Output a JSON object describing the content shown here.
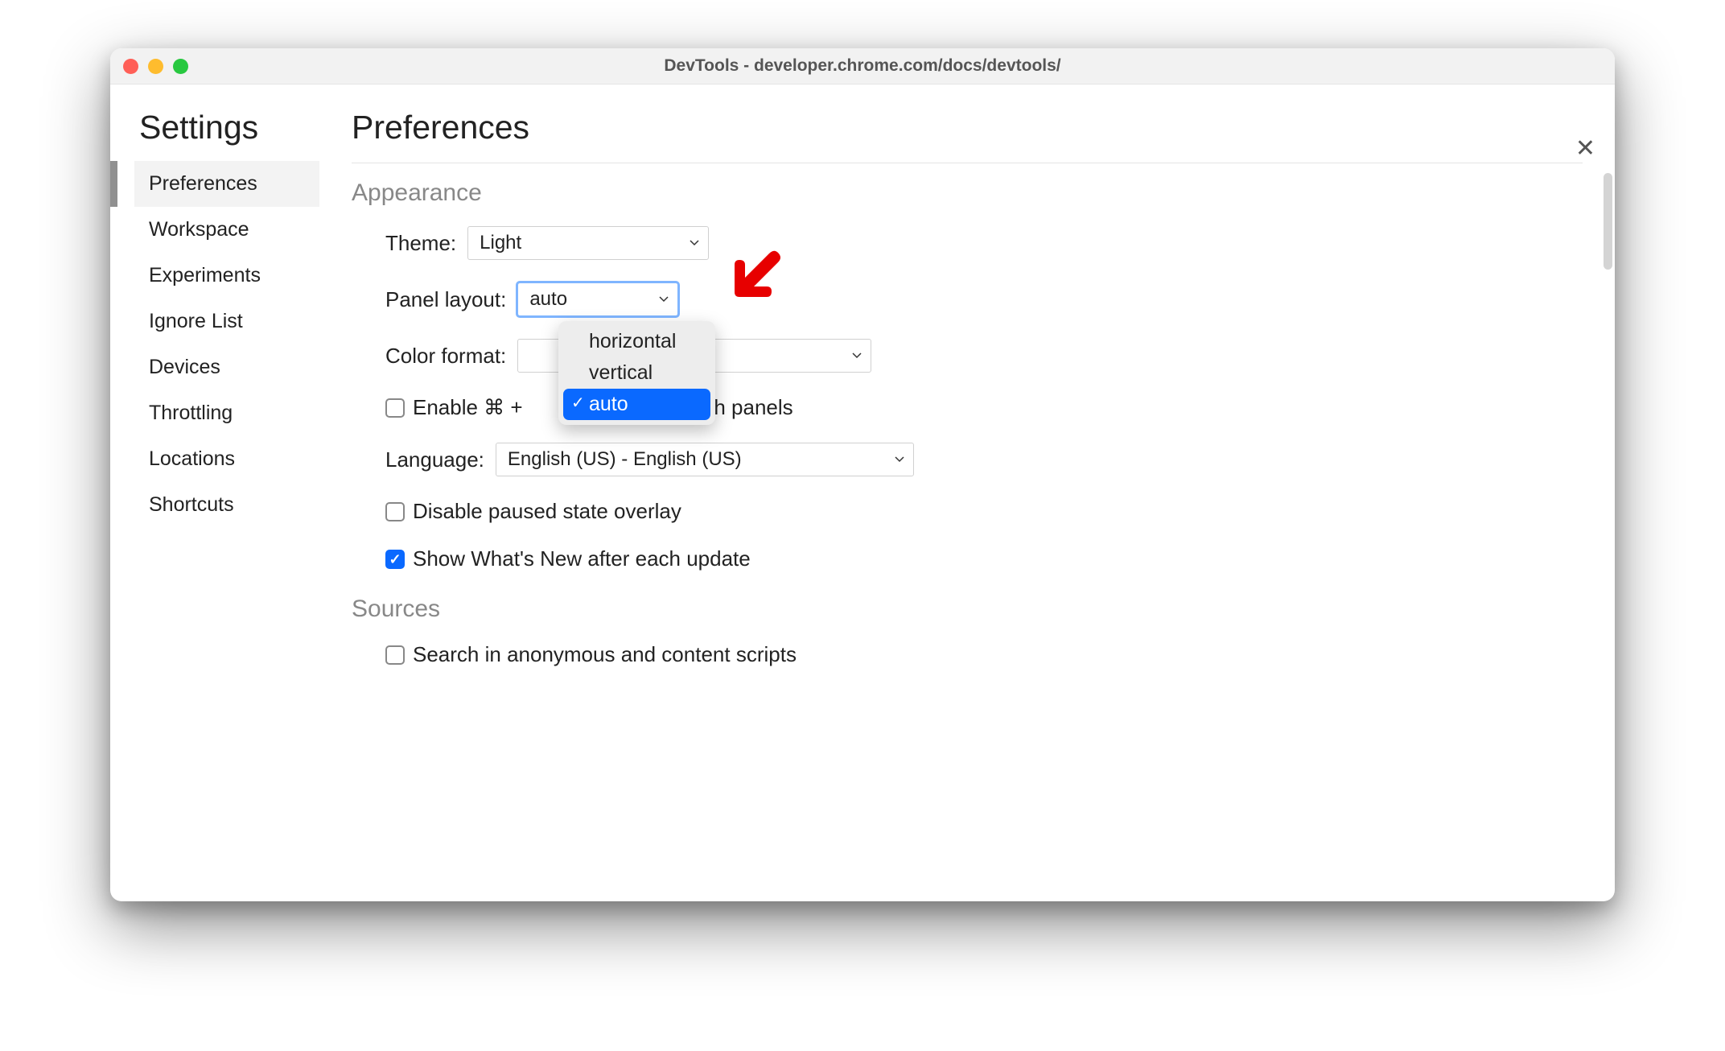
{
  "window": {
    "title": "DevTools - developer.chrome.com/docs/devtools/"
  },
  "sidebar": {
    "title": "Settings",
    "items": [
      {
        "label": "Preferences",
        "active": true
      },
      {
        "label": "Workspace",
        "active": false
      },
      {
        "label": "Experiments",
        "active": false
      },
      {
        "label": "Ignore List",
        "active": false
      },
      {
        "label": "Devices",
        "active": false
      },
      {
        "label": "Throttling",
        "active": false
      },
      {
        "label": "Locations",
        "active": false
      },
      {
        "label": "Shortcuts",
        "active": false
      }
    ]
  },
  "main": {
    "page_title": "Preferences",
    "appearance": {
      "section_label": "Appearance",
      "theme_label": "Theme:",
      "theme_value": "Light",
      "panel_layout_label": "Panel layout:",
      "panel_layout_value": "auto",
      "panel_layout_options": [
        {
          "label": "horizontal",
          "selected": false
        },
        {
          "label": "vertical",
          "selected": false
        },
        {
          "label": "auto",
          "selected": true
        }
      ],
      "color_format_label": "Color format:",
      "color_format_value": "",
      "shortcut_prefix": "Enable ⌘ + ",
      "shortcut_suffix": " switch panels",
      "language_label": "Language:",
      "language_value": "English (US) - English (US)",
      "disable_paused_label": "Disable paused state overlay",
      "disable_paused_checked": false,
      "whats_new_label": "Show What's New after each update",
      "whats_new_checked": true
    },
    "sources": {
      "section_label": "Sources",
      "search_anon_label": "Search in anonymous and content scripts",
      "search_anon_checked": false
    }
  },
  "colors": {
    "accent": "#0a69ff",
    "annotation": "#e70000"
  }
}
